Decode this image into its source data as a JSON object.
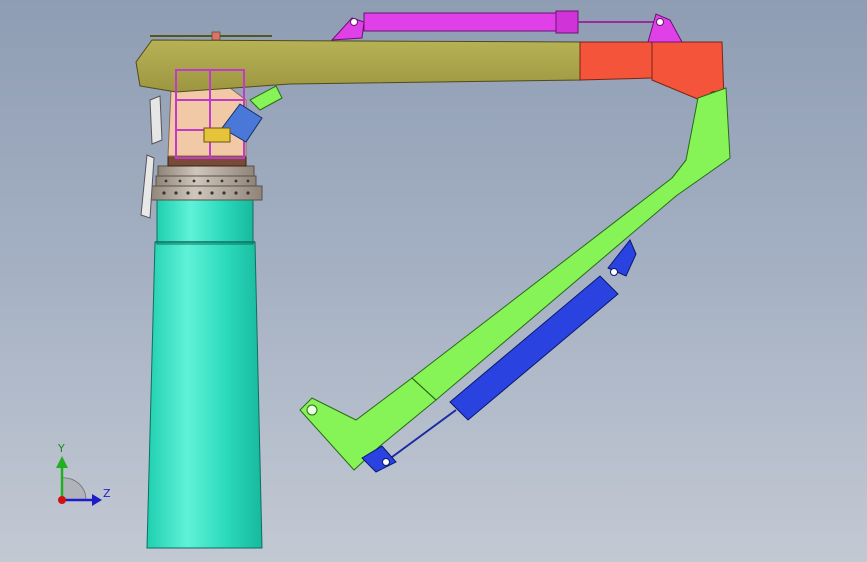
{
  "viewport": {
    "background_top": "#8f9db4",
    "background_bottom": "#c3c9d3"
  },
  "model": {
    "parts": [
      {
        "name": "pedestal-column",
        "color": "#33e6c6"
      },
      {
        "name": "slewing-ring",
        "color": "#b7b0a8"
      },
      {
        "name": "turret-base",
        "color": "#f2c9a6"
      },
      {
        "name": "main-boom",
        "color": "#a8a24a"
      },
      {
        "name": "boom-extension",
        "color": "#f4553a"
      },
      {
        "name": "luffing-cylinder",
        "color": "#e040e8"
      },
      {
        "name": "folding-arm",
        "color": "#86f457"
      },
      {
        "name": "folding-cylinder",
        "color": "#2a43e0"
      },
      {
        "name": "slew-motor",
        "color": "#4a78d8"
      },
      {
        "name": "handrail-cage",
        "color": "#c23ac8"
      }
    ]
  },
  "triad": {
    "y_label": "Y",
    "z_label": "Z",
    "y_color": "#22b022",
    "z_color": "#1d1dc8",
    "x_color": "#d01010"
  }
}
